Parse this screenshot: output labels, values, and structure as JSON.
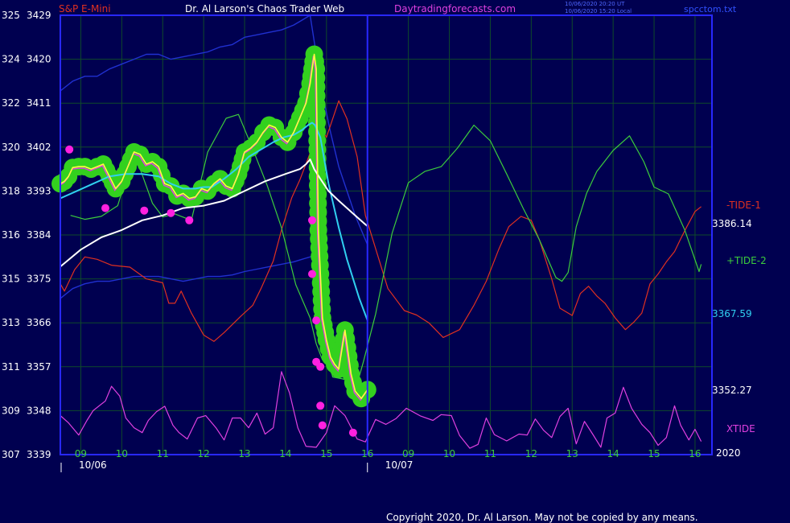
{
  "header": {
    "symbol": "S&P E-Mini",
    "title": "Dr. Al Larson's Chaos Trader Web",
    "site": "Daytradingforecasts.com",
    "stamp1": "10/06/2020 20:20 UT",
    "stamp2": "10/06/2020 15:20 Local",
    "file": "spcctom.txt"
  },
  "footer": {
    "copyright": "Copyright 2020, Dr. Al Larson. May not be copied by any means."
  },
  "year_label": "2020",
  "colors": {
    "background": "#000050",
    "grid": "#0f4a2a",
    "axis": "#2828ff",
    "price": "#ffff40",
    "bubble": "#33d11e",
    "minus_tide": "#e03020",
    "plus_tide": "#3ccc3c",
    "xtide": "#e040e0",
    "cyan_line": "#30d0f0",
    "white_line": "#ffffff",
    "band": "#2030d0"
  },
  "chart_data": {
    "type": "line",
    "title": "S&P E-Mini",
    "y_left_outer": [
      "325",
      "324",
      "322",
      "320",
      "318",
      "316",
      "315",
      "313",
      "311",
      "309",
      "307"
    ],
    "y_left_inner": [
      "3429",
      "3420",
      "3411",
      "3402",
      "3393",
      "3384",
      "3375",
      "3366",
      "3357",
      "3348",
      "3339"
    ],
    "ylim": [
      3339,
      3429
    ],
    "hour_ticks": [
      "09",
      "10",
      "11",
      "12",
      "13",
      "14",
      "15",
      "16",
      "09",
      "10",
      "11",
      "12",
      "13",
      "14",
      "15",
      "16"
    ],
    "dates": [
      "10/06",
      "10/07"
    ],
    "series_labels": {
      "minus_tide": "-TIDE-1",
      "plus_tide": "+TIDE-2",
      "xtide": "XTIDE"
    },
    "value_labels": {
      "white": "3386.14",
      "cyan": "3367.59",
      "last": "3352.27"
    },
    "series": [
      {
        "name": "-TIDE-1",
        "x": [
          8.5,
          8.6,
          8.85,
          9.1,
          9.4,
          9.75,
          10.2,
          10.6,
          11.0,
          11.15,
          11.3,
          11.45,
          11.7,
          12.0,
          12.25,
          12.5,
          12.9,
          13.2,
          13.4,
          13.7,
          13.9,
          14.15,
          14.35,
          14.6,
          14.8,
          15.0,
          15.3,
          15.5,
          15.75,
          15.95,
          16.5,
          16.9,
          17.2,
          17.5,
          17.85,
          18.25,
          18.6,
          18.9,
          19.2,
          19.45,
          19.75,
          20.0,
          20.2,
          20.5,
          20.7,
          21.0,
          21.2,
          21.4,
          21.6,
          21.8,
          22.05,
          22.3,
          22.5,
          22.7,
          22.9,
          23.1,
          23.3,
          23.5,
          23.65,
          23.8,
          24.0,
          24.15
        ],
        "y": [
          3374.0,
          3372.5,
          3376.9,
          3379.5,
          3379.0,
          3377.8,
          3377.4,
          3375.0,
          3374.2,
          3370.0,
          3370.0,
          3372.5,
          3368.0,
          3363.5,
          3362.2,
          3364.0,
          3367.3,
          3369.6,
          3373.0,
          3378.7,
          3385.0,
          3391.6,
          3395.3,
          3400.8,
          3407.0,
          3404.0,
          3411.5,
          3407.8,
          3400.0,
          3388.0,
          3373.0,
          3368.5,
          3367.6,
          3366.0,
          3363.0,
          3364.6,
          3369.6,
          3374.5,
          3380.9,
          3385.7,
          3387.8,
          3387.0,
          3383.0,
          3375.0,
          3369.0,
          3367.5,
          3372.0,
          3373.5,
          3371.5,
          3370.0,
          3367.0,
          3364.6,
          3366.1,
          3368.0,
          3374.0,
          3376.0,
          3378.5,
          3380.6,
          3383.2,
          3385.7,
          3388.8,
          3389.8
        ]
      },
      {
        "name": "+TIDE-2",
        "x": [
          8.75,
          9.1,
          9.5,
          9.9,
          10.3,
          10.75,
          11.0,
          11.3,
          11.7,
          12.1,
          12.55,
          12.85,
          13.2,
          13.55,
          13.9,
          14.25,
          14.6,
          14.75,
          14.9,
          15.0,
          15.15,
          15.4,
          15.75,
          15.9,
          16.2,
          16.6,
          17.0,
          17.4,
          17.8,
          18.2,
          18.6,
          19.0,
          19.4,
          19.8,
          20.2,
          20.6,
          20.75,
          20.9,
          21.1,
          21.35,
          21.6,
          22.0,
          22.4,
          22.75,
          23.0,
          23.35,
          23.75,
          24.1,
          24.15
        ],
        "y": [
          3388.0,
          3387.2,
          3387.8,
          3390.0,
          3401.0,
          3390.5,
          3387.7,
          3388.3,
          3387.0,
          3401.0,
          3407.9,
          3408.7,
          3401.6,
          3394.2,
          3385.5,
          3373.8,
          3367.0,
          3361.7,
          3358.4,
          3360.4,
          3354.9,
          3354.5,
          3353.5,
          3358.0,
          3367.8,
          3384.3,
          3394.7,
          3397.0,
          3398.0,
          3401.8,
          3406.5,
          3403.3,
          3396.5,
          3389.5,
          3383.0,
          3375.3,
          3374.5,
          3376.3,
          3385.7,
          3392.5,
          3397.0,
          3401.3,
          3404.3,
          3399.0,
          3393.8,
          3392.4,
          3385.0,
          3376.5,
          3378.0
        ]
      },
      {
        "name": "XTIDE",
        "x": [
          8.5,
          8.7,
          8.95,
          9.15,
          9.3,
          9.6,
          9.75,
          9.95,
          10.1,
          10.3,
          10.5,
          10.65,
          10.85,
          11.05,
          11.25,
          11.4,
          11.6,
          11.85,
          12.05,
          12.3,
          12.5,
          12.7,
          12.9,
          13.1,
          13.3,
          13.5,
          13.7,
          13.9,
          14.1,
          14.3,
          14.5,
          14.75,
          15.0,
          15.2,
          15.45,
          15.75,
          15.95,
          16.2,
          16.45,
          16.7,
          16.95,
          17.3,
          17.6,
          17.8,
          18.05,
          18.25,
          18.5,
          18.7,
          18.9,
          19.1,
          19.4,
          19.7,
          19.9,
          20.1,
          20.3,
          20.5,
          20.7,
          20.9,
          21.1,
          21.3,
          21.5,
          21.7,
          21.85,
          22.05,
          22.25,
          22.45,
          22.7,
          22.9,
          23.1,
          23.3,
          23.5,
          23.65,
          23.85,
          24.0,
          24.15
        ],
        "y": [
          3347.0,
          3345.5,
          3343.0,
          3346.0,
          3348.0,
          3350.0,
          3353.0,
          3351.0,
          3346.5,
          3344.5,
          3343.5,
          3346.0,
          3347.8,
          3348.9,
          3345.0,
          3343.5,
          3342.2,
          3346.5,
          3347.0,
          3344.5,
          3342.0,
          3346.5,
          3346.5,
          3344.5,
          3347.5,
          3343.2,
          3344.5,
          3356.0,
          3351.6,
          3344.5,
          3340.7,
          3340.5,
          3343.5,
          3349.0,
          3347.0,
          3342.2,
          3341.6,
          3346.2,
          3345.2,
          3346.4,
          3348.5,
          3346.9,
          3346.0,
          3347.2,
          3347.0,
          3342.9,
          3340.3,
          3341.1,
          3346.5,
          3343.1,
          3341.8,
          3343.2,
          3343.0,
          3346.3,
          3344.0,
          3342.5,
          3346.8,
          3348.5,
          3341.2,
          3345.8,
          3343.2,
          3340.5,
          3346.5,
          3347.5,
          3352.8,
          3348.5,
          3345.2,
          3343.5,
          3340.9,
          3342.5,
          3349.0,
          3345.0,
          3342.0,
          3344.2,
          3341.7
        ]
      },
      {
        "name": "price",
        "x": [
          8.5,
          8.6,
          8.7,
          8.8,
          8.95,
          9.1,
          9.25,
          9.4,
          9.55,
          9.7,
          9.85,
          10.0,
          10.15,
          10.3,
          10.45,
          10.6,
          10.75,
          10.9,
          11.05,
          11.2,
          11.35,
          11.5,
          11.65,
          11.8,
          11.95,
          12.1,
          12.25,
          12.4,
          12.55,
          12.7,
          12.85,
          13.0,
          13.15,
          13.3,
          13.45,
          13.6,
          13.75,
          13.9,
          14.05,
          14.2,
          14.35,
          14.5,
          14.6,
          14.65,
          14.7,
          14.75,
          14.8,
          14.9,
          15.0,
          15.1,
          15.2,
          15.3,
          15.45,
          15.6,
          15.7,
          15.85,
          16.0
        ],
        "y": [
          3394.5,
          3395.0,
          3396.0,
          3397.8,
          3398.0,
          3398.0,
          3397.5,
          3398.0,
          3398.5,
          3396.0,
          3393.5,
          3395.0,
          3398.0,
          3401.0,
          3400.5,
          3398.5,
          3399.0,
          3398.0,
          3394.5,
          3394.0,
          3392.0,
          3392.5,
          3391.5,
          3391.8,
          3393.5,
          3393.0,
          3394.5,
          3395.5,
          3394.0,
          3393.5,
          3396.5,
          3401.0,
          3401.8,
          3403.0,
          3405.0,
          3406.5,
          3406.0,
          3404.0,
          3403.0,
          3405.0,
          3408.0,
          3411.0,
          3415.0,
          3418.0,
          3421.0,
          3418.0,
          3385.0,
          3367.0,
          3362.5,
          3359.0,
          3357.5,
          3356.5,
          3364.5,
          3355.5,
          3352.0,
          3350.5,
          3352.3
        ]
      },
      {
        "name": "cyan",
        "x": [
          8.5,
          8.9,
          9.3,
          9.7,
          10.1,
          10.5,
          10.9,
          11.2,
          11.5,
          11.8,
          12.0,
          12.2,
          12.5,
          12.8,
          13.1,
          13.4,
          13.7,
          13.95,
          14.2,
          14.4,
          14.55,
          14.65,
          14.72,
          14.85,
          15.05,
          15.3,
          15.5,
          15.8,
          16.0
        ],
        "y": [
          3391.5,
          3393.0,
          3394.5,
          3396.0,
          3396.5,
          3396.5,
          3396.0,
          3394.5,
          3393.5,
          3393.5,
          3393.8,
          3393.8,
          3395.5,
          3397.5,
          3400.0,
          3401.5,
          3403.0,
          3404.0,
          3404.5,
          3405.5,
          3406.5,
          3407.0,
          3406.5,
          3404.0,
          3394.5,
          3385.5,
          3379.0,
          3371.0,
          3366.5
        ]
      },
      {
        "name": "white",
        "x": [
          8.5,
          9.0,
          9.5,
          10.0,
          10.5,
          11.0,
          11.5,
          12.0,
          12.5,
          13.0,
          13.5,
          14.0,
          14.35,
          14.5,
          14.6,
          14.7,
          14.85,
          15.05,
          15.3,
          15.5,
          15.7,
          15.9,
          16.0
        ],
        "y": [
          3377.5,
          3381.0,
          3383.5,
          3385.0,
          3387.0,
          3388.0,
          3389.5,
          3390.0,
          3391.0,
          3393.0,
          3395.0,
          3396.5,
          3397.5,
          3398.5,
          3399.5,
          3397.5,
          3395.5,
          3393.0,
          3391.0,
          3389.5,
          3388.0,
          3386.5,
          3385.8
        ]
      },
      {
        "name": "upper-band",
        "x": [
          8.5,
          8.8,
          9.1,
          9.4,
          9.7,
          10.0,
          10.3,
          10.6,
          10.9,
          11.2,
          11.5,
          11.8,
          12.1,
          12.4,
          12.7,
          13.0,
          13.3,
          13.6,
          13.9,
          14.2,
          14.4,
          14.6,
          14.75,
          14.9,
          15.1,
          15.3,
          15.5,
          15.7,
          15.9,
          16.0
        ],
        "y": [
          3413.5,
          3415.5,
          3416.5,
          3416.5,
          3418.0,
          3419.0,
          3420.0,
          3421.0,
          3421.0,
          3420.0,
          3420.5,
          3421.0,
          3421.5,
          3422.5,
          3423.0,
          3424.5,
          3425.0,
          3425.5,
          3426.0,
          3427.0,
          3428.0,
          3429.0,
          3421.0,
          3413.0,
          3405.0,
          3398.0,
          3393.0,
          3388.0,
          3384.0,
          3382.0
        ]
      },
      {
        "name": "lower-band",
        "x": [
          8.5,
          8.8,
          9.1,
          9.4,
          9.7,
          10.0,
          10.3,
          10.6,
          10.9,
          11.2,
          11.5,
          11.8,
          12.1,
          12.4,
          12.7,
          13.0,
          13.3,
          13.6,
          13.9,
          14.2,
          14.4,
          14.6,
          14.7
        ],
        "y": [
          3371.0,
          3373.0,
          3374.0,
          3374.5,
          3374.5,
          3375.0,
          3375.5,
          3375.5,
          3375.5,
          3375.0,
          3374.5,
          3375.0,
          3375.5,
          3375.5,
          3375.8,
          3376.5,
          3377.0,
          3377.5,
          3378.0,
          3378.5,
          3379.0,
          3379.5,
          3380.0
        ]
      }
    ],
    "swing_markers": [
      {
        "x": 8.72,
        "y": 3401.5
      },
      {
        "x": 9.6,
        "y": 3389.5
      },
      {
        "x": 10.55,
        "y": 3389.0
      },
      {
        "x": 11.2,
        "y": 3388.5
      },
      {
        "x": 11.65,
        "y": 3387.0
      },
      {
        "x": 14.65,
        "y": 3387.0
      },
      {
        "x": 14.65,
        "y": 3376.0
      },
      {
        "x": 14.75,
        "y": 3366.5
      },
      {
        "x": 14.75,
        "y": 3358.0
      },
      {
        "x": 14.85,
        "y": 3357.0
      },
      {
        "x": 14.85,
        "y": 3349.0
      },
      {
        "x": 14.9,
        "y": 3345.0
      },
      {
        "x": 15.65,
        "y": 3343.5
      }
    ]
  }
}
